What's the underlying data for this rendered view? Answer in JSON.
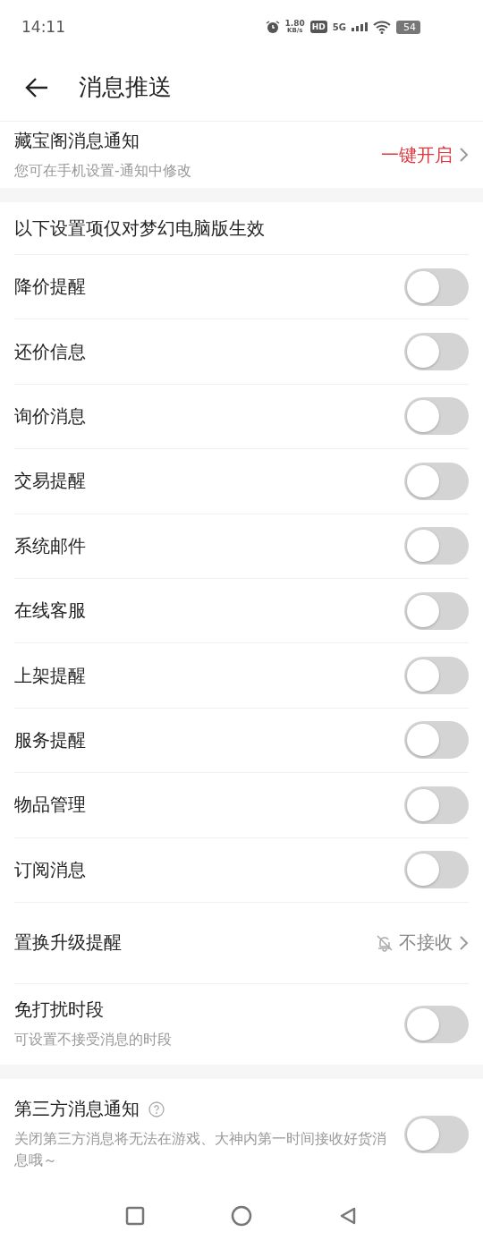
{
  "status_bar": {
    "time": "14:11",
    "speed": "1.80",
    "speed_unit": "KB/s",
    "hd": "HD",
    "network": "5G",
    "battery": "54"
  },
  "header": {
    "title": "消息推送"
  },
  "app_notice": {
    "title": "藏宝阁消息通知",
    "subtitle": "您可在手机设置-通知中修改",
    "action": "一键开启"
  },
  "section": {
    "title": "以下设置项仅对梦幻电脑版生效"
  },
  "settings": [
    {
      "kind": "toggle",
      "label": "降价提醒",
      "on": false
    },
    {
      "kind": "toggle",
      "label": "还价信息",
      "on": false
    },
    {
      "kind": "toggle",
      "label": "询价消息",
      "on": false
    },
    {
      "kind": "toggle",
      "label": "交易提醒",
      "on": false
    },
    {
      "kind": "toggle",
      "label": "系统邮件",
      "on": false
    },
    {
      "kind": "toggle",
      "label": "在线客服",
      "on": false
    },
    {
      "kind": "toggle",
      "label": "上架提醒",
      "on": false
    },
    {
      "kind": "toggle",
      "label": "服务提醒",
      "on": false
    },
    {
      "kind": "toggle",
      "label": "物品管理",
      "on": false
    },
    {
      "kind": "toggle",
      "label": "订阅消息",
      "on": false
    },
    {
      "kind": "link",
      "label": "置换升级提醒",
      "value": "不接收"
    },
    {
      "kind": "toggle",
      "label": "免打扰时段",
      "subtitle": "可设置不接受消息的时段",
      "on": false
    }
  ],
  "third_party": {
    "title": "第三方消息通知",
    "subtitle": "关闭第三方消息将无法在游戏、大神内第一时间接收好货消息哦～",
    "on": false
  }
}
